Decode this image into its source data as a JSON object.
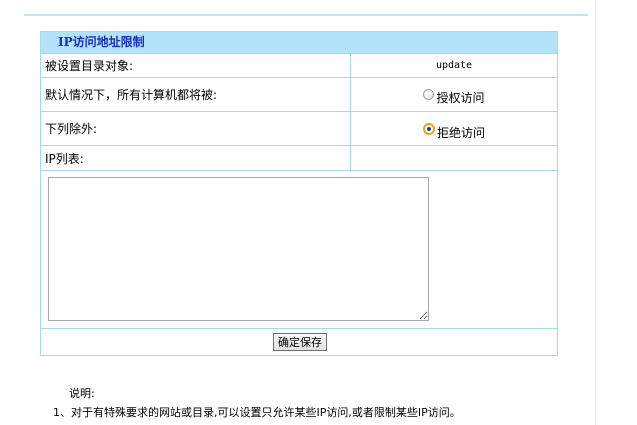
{
  "panel": {
    "title": "IP访问地址限制",
    "rows": [
      {
        "label": "被设置目录对象:",
        "value": "update"
      },
      {
        "label": "默认情况下，所有计算机都将被:",
        "option_label": "授权访问",
        "checked": false
      },
      {
        "label": "下列除外:",
        "option_label": "拒绝访问",
        "checked": true
      },
      {
        "label": "IP列表:",
        "value": ""
      }
    ],
    "ip_list_value": "",
    "save_button_label": "确定保存"
  },
  "notes": {
    "heading": "说明:",
    "items": [
      "1、对于有特殊要求的网站或目录,可以设置只允许某些IP访问,或者限制某些IP访问。"
    ]
  },
  "colors": {
    "title_bar": "#b3e3fb",
    "title_text": "#1a2fb8",
    "border": "#a8d8ee"
  }
}
